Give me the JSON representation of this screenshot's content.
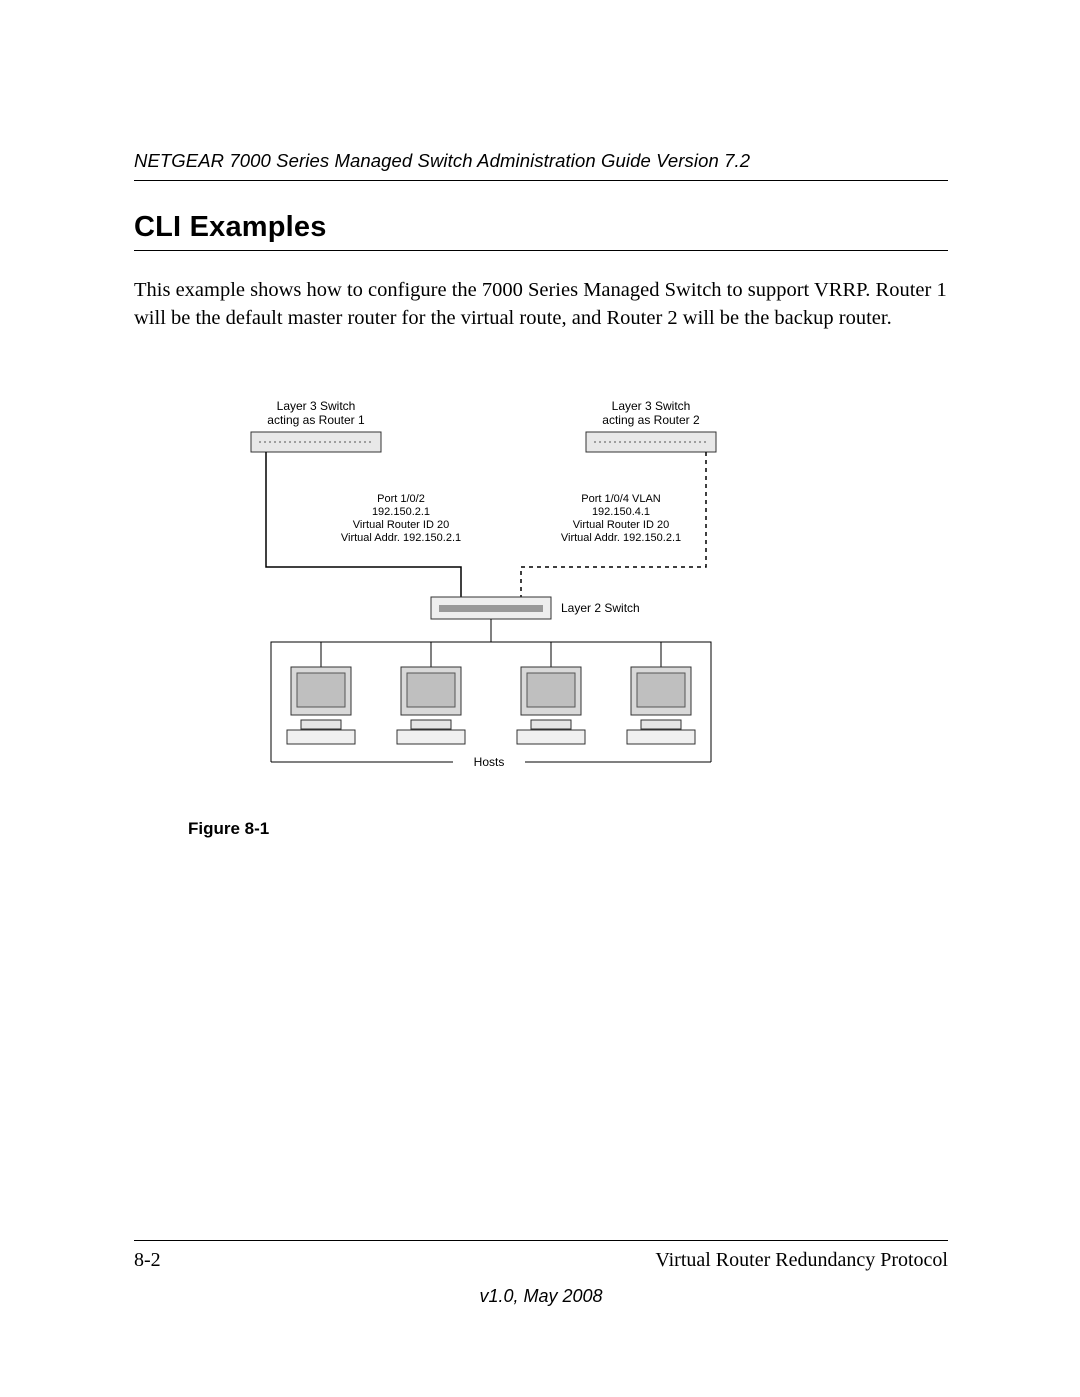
{
  "header": {
    "running_head": "NETGEAR 7000 Series Managed Switch Administration Guide Version 7.2"
  },
  "section": {
    "title": "CLI Examples",
    "paragraph": "This example shows how to configure the 7000 Series Managed Switch to support VRRP. Router 1 will be the default master router for the virtual route, and Router 2 will be the backup router."
  },
  "figure": {
    "caption": "Figure 8-1",
    "router1": {
      "line1": "Layer 3 Switch",
      "line2": "acting as Router 1"
    },
    "router2": {
      "line1": "Layer 3 Switch",
      "line2": "acting as Router 2"
    },
    "port1": {
      "l1": "Port 1/0/2",
      "l2": "192.150.2.1",
      "l3": "Virtual Router ID 20",
      "l4": "Virtual Addr. 192.150.2.1"
    },
    "port2": {
      "l1": "Port 1/0/4 VLAN",
      "l2": "192.150.4.1",
      "l3": "Virtual Router ID 20",
      "l4": "Virtual Addr. 192.150.2.1"
    },
    "l2switch": "Layer 2 Switch",
    "hosts": "Hosts"
  },
  "footer": {
    "page": "8-2",
    "chapter": "Virtual Router Redundancy Protocol",
    "version": "v1.0, May 2008"
  }
}
